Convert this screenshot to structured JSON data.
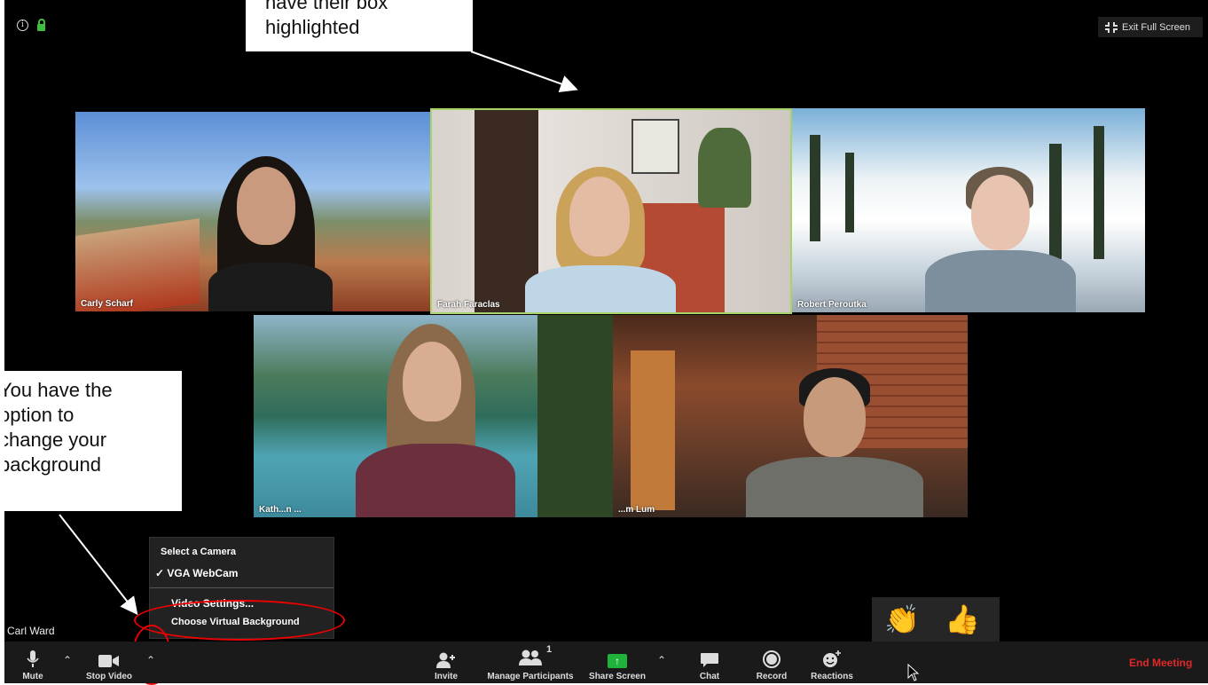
{
  "colors": {
    "toolbar_bg": "#1a1a1a",
    "end_meeting": "#e02828",
    "active_speaker": "#a8d26a",
    "share_green": "#1fb33a",
    "annotation_red": "#e00000"
  },
  "top_bar": {
    "info_icon": "info-icon",
    "lock_icon": "lock-icon",
    "exit_full_screen": "Exit Full Screen"
  },
  "callouts": {
    "top_lines": [
      "have their box",
      "highlighted"
    ],
    "left_lines": [
      "You have the",
      "option to",
      "change your",
      "background"
    ]
  },
  "participants": [
    {
      "name": "Carly Scharf"
    },
    {
      "name": "Farah Faraclas"
    },
    {
      "name": "Robert Peroutka"
    },
    {
      "name": "Kath...n ..."
    },
    {
      "name": "...m Lum"
    }
  ],
  "self_view_name": "Carl Ward",
  "camera_menu": {
    "header": "Select a Camera",
    "checkmark": "✓",
    "camera": "VGA WebCam",
    "video_settings": "Video Settings...",
    "virtual_background": "Choose Virtual Background"
  },
  "toolbar": {
    "mute": "Mute",
    "stop_video": "Stop Video",
    "invite": "Invite",
    "manage_participants": "Manage Participants",
    "participant_count": "1",
    "share_screen": "Share Screen",
    "chat": "Chat",
    "record": "Record",
    "reactions": "Reactions",
    "end_meeting": "End Meeting"
  },
  "reactions_popup": {
    "clap": "👏",
    "thumbs_up": "👍"
  }
}
